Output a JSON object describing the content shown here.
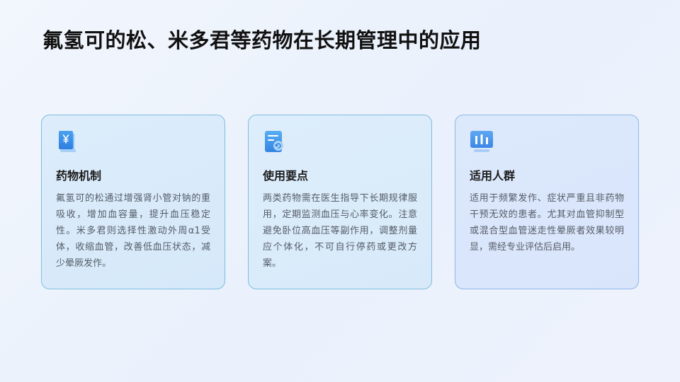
{
  "title": "氟氢可的松、米多君等药物在长期管理中的应用",
  "colors": {
    "accent": "#3d8ee8",
    "card_border": "#7fbde0",
    "title": "#111111",
    "body_text": "#555c66"
  },
  "cards": [
    {
      "icon": "scroll-yen-icon",
      "heading": "药物机制",
      "body": "氟氢可的松通过增强肾小管对钠的重吸收，增加血容量，提升血压稳定性。米多君则选择性激动外周α1受体，收缩血管，改善低血压状态，减少晕厥发作。"
    },
    {
      "icon": "document-refresh-icon",
      "heading": "使用要点",
      "body": "两类药物需在医生指导下长期规律服用，定期监测血压与心率变化。注意避免卧位高血压等副作用，调整剂量应个体化，不可自行停药或更改方案。"
    },
    {
      "icon": "bar-chart-icon",
      "heading": "适用人群",
      "body": "适用于频繁发作、症状严重且非药物干预无效的患者。尤其对血管抑制型或混合型血管迷走性晕厥者效果较明显，需经专业评估后启用。"
    }
  ]
}
